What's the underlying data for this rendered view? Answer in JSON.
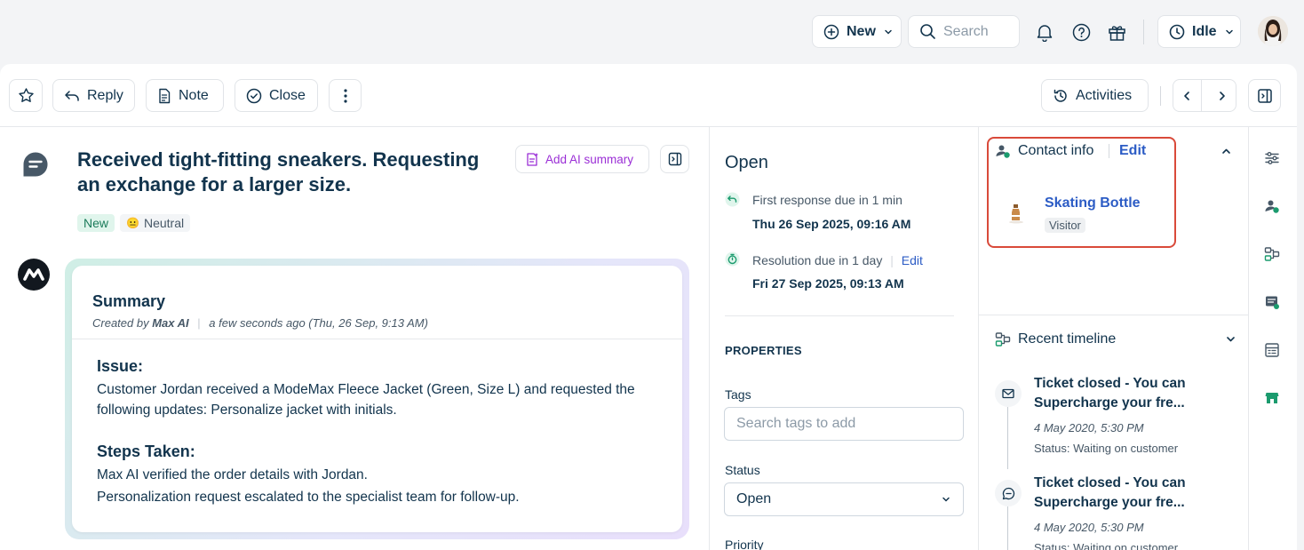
{
  "topbar": {
    "new_label": "New",
    "search_placeholder": "Search",
    "status_label": "Idle"
  },
  "toolbar": {
    "reply_label": "Reply",
    "note_label": "Note",
    "close_label": "Close",
    "activities_label": "Activities"
  },
  "ticket": {
    "title": "Received tight-fitting sneakers. Requesting an exchange for a larger size.",
    "add_ai_summary_label": "Add AI summary",
    "status_pill": "New",
    "sentiment_label": "Neutral",
    "sentiment_emoji": "😐"
  },
  "summary": {
    "title": "Summary",
    "created_by_prefix": "Created by ",
    "created_by": "Max AI",
    "timestamp": "a few seconds ago (Thu, 26 Sep, 9:13 AM)",
    "issue_heading": "Issue:",
    "issue_text": "Customer Jordan received a ModeMax Fleece Jacket (Green, Size L) and requested the following updates: Personalize jacket with initials.",
    "steps_heading": "Steps Taken:",
    "step_1": "Max AI verified the order details with Jordan.",
    "step_2": "Personalization request escalated to the specialist team for follow-up."
  },
  "details": {
    "status_title": "Open",
    "first_response_label": "First response due in 1 min",
    "first_response_date": "Thu 26 Sep 2025, 09:16 AM",
    "resolution_label": "Resolution due in 1 day",
    "resolution_edit": "Edit",
    "resolution_date": "Fri 27 Sep 2025, 09:13 AM",
    "properties_heading": "PROPERTIES",
    "tags_label": "Tags",
    "tags_placeholder": "Search tags to add",
    "status_label": "Status",
    "status_value": "Open",
    "priority_label": "Priority"
  },
  "contact": {
    "heading": "Contact info",
    "edit_label": "Edit",
    "name": "Skating Bottle",
    "type": "Visitor"
  },
  "timeline": {
    "heading": "Recent timeline",
    "items": [
      {
        "title": "Ticket closed - You can Supercharge your fre...",
        "date": "4 May 2020, 5:30 PM",
        "status": "Status: Waiting on customer"
      },
      {
        "title": "Ticket closed - You can Supercharge your fre...",
        "date": "4 May 2020, 5:30 PM",
        "status": "Status: Waiting on customer"
      }
    ]
  },
  "colors": {
    "highlight_border": "#d94a3a",
    "link": "#2c5cc5",
    "ai_purple": "#9b2fd6",
    "new_pill_bg": "#e0f5ec",
    "new_pill_text": "#1b7b5a"
  }
}
